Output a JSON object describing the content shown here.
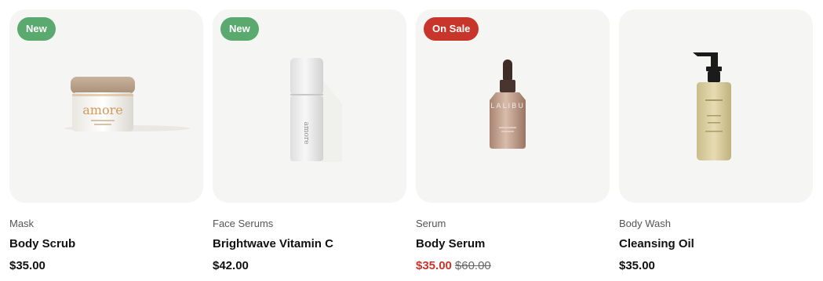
{
  "colors": {
    "card_bg": "#f5f5f3",
    "badge_new": "#5aa96e",
    "badge_sale": "#c8352a",
    "sale_price": "#c8352a"
  },
  "products": [
    {
      "badge": "New",
      "badge_type": "new",
      "image_icon": "jar-icon",
      "brand_text": "amore",
      "category": "Mask",
      "name": "Body Scrub",
      "price": "$35.00",
      "old_price": ""
    },
    {
      "badge": "New",
      "badge_type": "new",
      "image_icon": "bottle-icon",
      "brand_text": "amore",
      "category": "Face Serums",
      "name": "Brightwave Vitamin C",
      "price": "$42.00",
      "old_price": ""
    },
    {
      "badge": "On Sale",
      "badge_type": "sale",
      "image_icon": "dropper-bottle-icon",
      "brand_text": "LALIBU",
      "category": "Serum",
      "name": "Body Serum",
      "price": "$35.00",
      "old_price": "$60.00"
    },
    {
      "badge": "",
      "badge_type": "",
      "image_icon": "pump-bottle-icon",
      "brand_text": "",
      "category": "Body Wash",
      "name": "Cleansing Oil",
      "price": "$35.00",
      "old_price": ""
    }
  ]
}
